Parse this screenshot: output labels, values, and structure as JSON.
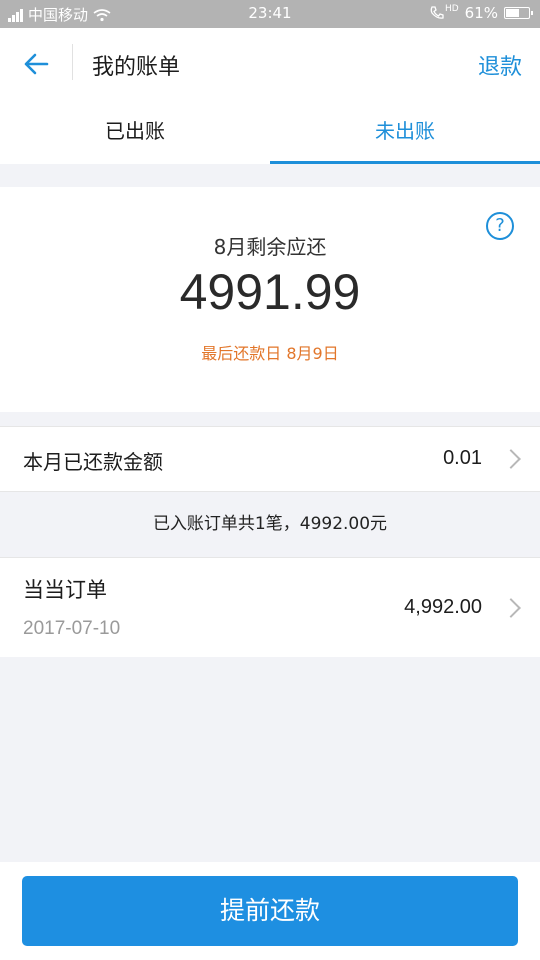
{
  "status_bar": {
    "carrier": "中国移动",
    "time": "23:41",
    "network": "HD",
    "battery": "61%",
    "battery_level": 0.61
  },
  "header": {
    "back_icon": "arrow-left-icon",
    "title": "我的账单",
    "action": "退款"
  },
  "tabs": [
    {
      "label": "已出账",
      "active": false
    },
    {
      "label": "未出账",
      "active": true
    }
  ],
  "summary": {
    "label": "8月剩余应还",
    "amount": "4991.99",
    "due_date": "最后还款日 8月9日",
    "help_icon": "?"
  },
  "paid_row": {
    "label": "本月已还款金额",
    "value": "0.01"
  },
  "info_text": "已入账订单共1笔，4992.00元",
  "orders": [
    {
      "title": "当当订单",
      "date": "2017-07-10",
      "amount": "4,992.00"
    }
  ],
  "bottom_button": "提前还款",
  "colors": {
    "accent": "#1e8fd9",
    "button": "#1e8fe1",
    "warning": "#e2762a",
    "background": "#f2f3f7"
  }
}
